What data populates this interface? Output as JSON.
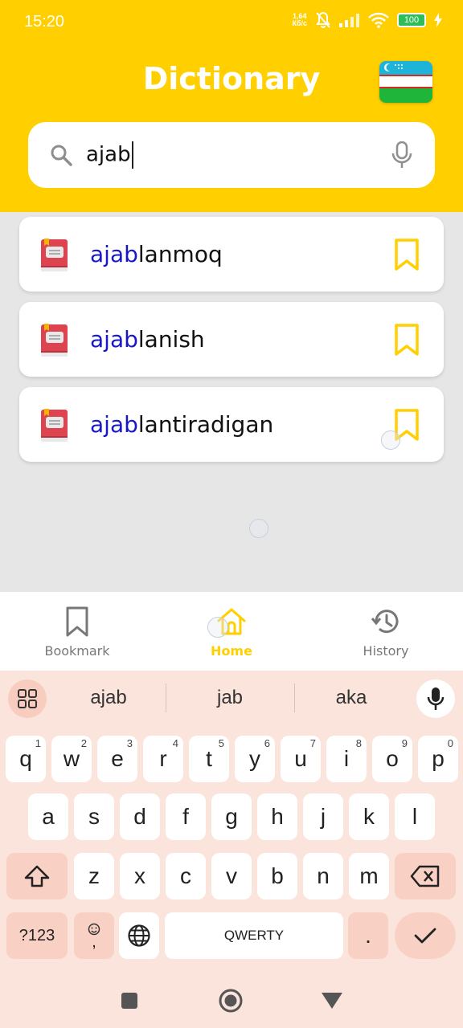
{
  "status_bar": {
    "time": "15:20",
    "net_speed_value": "1,64",
    "net_speed_unit": "Кб/с",
    "battery": "100"
  },
  "header": {
    "title": "Dictionary",
    "flag_icon": "uzbekistan-flag"
  },
  "search": {
    "value": "ajab",
    "search_icon": "search-icon",
    "mic_icon": "mic-icon"
  },
  "results": [
    {
      "highlight": "ajab",
      "rest": "lanmoq"
    },
    {
      "highlight": "ajab",
      "rest": "lanish"
    },
    {
      "highlight": "ajab",
      "rest": "lantiradigan"
    }
  ],
  "bottom_nav": {
    "items": [
      {
        "label": "Bookmark",
        "icon": "bookmark-icon",
        "active": false
      },
      {
        "label": "Home",
        "icon": "home-icon",
        "active": true
      },
      {
        "label": "History",
        "icon": "history-icon",
        "active": false
      }
    ]
  },
  "keyboard": {
    "suggestions": [
      "ajab",
      "jab",
      "aka"
    ],
    "row1": [
      {
        "k": "q",
        "n": "1"
      },
      {
        "k": "w",
        "n": "2"
      },
      {
        "k": "e",
        "n": "3"
      },
      {
        "k": "r",
        "n": "4"
      },
      {
        "k": "t",
        "n": "5"
      },
      {
        "k": "y",
        "n": "6"
      },
      {
        "k": "u",
        "n": "7"
      },
      {
        "k": "i",
        "n": "8"
      },
      {
        "k": "o",
        "n": "9"
      },
      {
        "k": "p",
        "n": "0"
      }
    ],
    "row2": [
      "a",
      "s",
      "d",
      "f",
      "g",
      "h",
      "j",
      "k",
      "l"
    ],
    "row3": [
      "z",
      "x",
      "c",
      "v",
      "b",
      "n",
      "m"
    ],
    "symbols_label": "?123",
    "emoji_comma": ",",
    "space_label": "QWERTY",
    "period": "."
  },
  "colors": {
    "accent": "#ffcf00",
    "highlight": "#1818c8",
    "keyboard_bg": "#fbe4dc"
  }
}
